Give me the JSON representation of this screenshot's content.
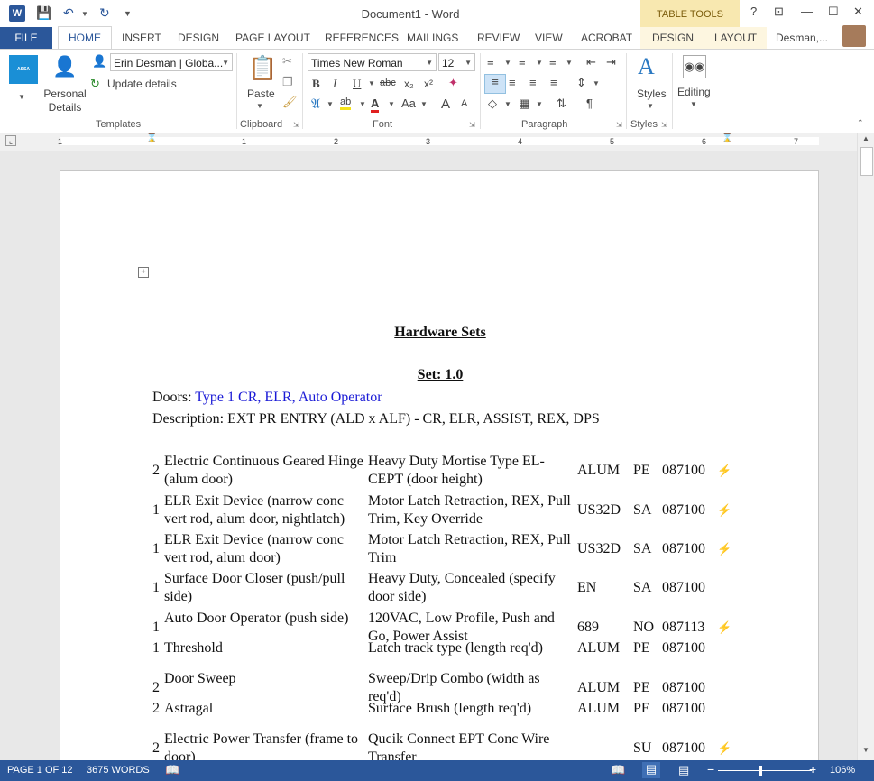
{
  "titlebar": {
    "doc_title": "Document1 - Word",
    "contextual_header": "TABLE TOOLS",
    "help": "?",
    "ribbon_display": "⊡",
    "minimize": "—",
    "maximize": "☐",
    "close": "✕"
  },
  "tabs": {
    "file": "FILE",
    "home": "HOME",
    "insert": "INSERT",
    "design": "DESIGN",
    "page_layout": "PAGE LAYOUT",
    "references": "REFERENCES",
    "mailings": "MAILINGS",
    "review": "REVIEW",
    "view": "VIEW",
    "acrobat": "ACROBAT",
    "table_design": "DESIGN",
    "table_layout": "LAYOUT",
    "user": "Desman,..."
  },
  "ribbon": {
    "templates": {
      "profile_value": "Erin Desman | Globa...",
      "personal_details": "Personal Details",
      "update_details": "Update details",
      "label": "Templates",
      "logo_text": "ASSA ABLOY"
    },
    "clipboard": {
      "paste": "Paste",
      "label": "Clipboard"
    },
    "font": {
      "family": "Times New Roman",
      "size": "12",
      "bold": "B",
      "italic": "I",
      "underline": "U",
      "strike": "abc",
      "subscript": "x₂",
      "superscript": "x²",
      "change_case": "Aa",
      "grow": "A",
      "shrink": "A",
      "label": "Font"
    },
    "paragraph": {
      "label": "Paragraph"
    },
    "styles": {
      "button": "Styles",
      "label": "Styles"
    },
    "editing": {
      "button": "Editing"
    }
  },
  "ruler": {
    "numbers": [
      "1",
      "1",
      "2",
      "3",
      "4",
      "5",
      "6",
      "7"
    ]
  },
  "document": {
    "title": "Hardware Sets",
    "set_heading": "Set: 1.0",
    "doors_label": "Doors: ",
    "doors_value": "Type 1 CR, ELR, Auto Operator",
    "description": "Description: EXT PR ENTRY (ALD x ALF) - CR, ELR, ASSIST, REX, DPS",
    "rows": [
      {
        "qty": "2",
        "item": "Electric Continuous Geared Hinge (alum door)",
        "desc": "Heavy Duty Mortise Type EL-CEPT (door height)",
        "finish": "ALUM",
        "mfr": "PE",
        "section": "087100",
        "electric": "⚡"
      },
      {
        "qty": "1",
        "item": "ELR Exit Device (narrow conc vert rod, alum door, nightlatch)",
        "desc": "Motor Latch Retraction, REX, Pull Trim, Key Override",
        "finish": "US32D",
        "mfr": "SA",
        "section": "087100",
        "electric": "⚡"
      },
      {
        "qty": "1",
        "item": "ELR Exit Device (narrow conc vert rod, alum door)",
        "desc": "Motor Latch Retraction, REX, Pull Trim",
        "finish": "US32D",
        "mfr": "SA",
        "section": "087100",
        "electric": "⚡"
      },
      {
        "qty": "1",
        "item": "Surface Door Closer (push/pull side)",
        "desc": "Heavy Duty, Concealed (specify door side)",
        "finish": "EN",
        "mfr": "SA",
        "section": "087100",
        "electric": ""
      },
      {
        "qty": "1",
        "item": "Auto Door Operator (push side)",
        "desc": "120VAC, Low Profile, Push and Go, Power Assist",
        "finish": "689",
        "mfr": "NO",
        "section": "087113",
        "electric": "⚡"
      },
      {
        "qty": "1",
        "item": "Threshold",
        "desc": "Latch track type (length req'd)",
        "finish": "ALUM",
        "mfr": "PE",
        "section": "087100",
        "electric": ""
      },
      {
        "qty": "2",
        "item": "Door Sweep",
        "desc": "Sweep/Drip Combo (width as req'd)",
        "finish": "ALUM",
        "mfr": "PE",
        "section": "087100",
        "electric": ""
      },
      {
        "qty": "2",
        "item": "Astragal",
        "desc": "Surface Brush (length req'd)",
        "finish": "ALUM",
        "mfr": "PE",
        "section": "087100",
        "electric": ""
      },
      {
        "qty": "2",
        "item": "Electric Power Transfer (frame to door)",
        "desc": "Qucik Connect EPT Conc Wire Transfer",
        "finish": "",
        "mfr": "SU",
        "section": "087100",
        "electric": "⚡"
      }
    ]
  },
  "statusbar": {
    "page": "PAGE 1 OF 12",
    "words": "3675 WORDS",
    "zoom_minus": "−",
    "zoom_plus": "+",
    "zoom": "106%",
    "zoom_fraction": 0.45
  }
}
